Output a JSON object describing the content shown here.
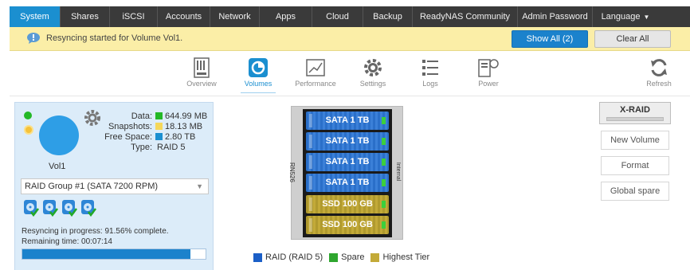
{
  "nav": {
    "items": [
      {
        "label": "System",
        "active": true
      },
      {
        "label": "Shares"
      },
      {
        "label": "iSCSI"
      },
      {
        "label": "Accounts"
      },
      {
        "label": "Network"
      },
      {
        "label": "Apps"
      },
      {
        "label": "Cloud"
      },
      {
        "label": "Backup"
      },
      {
        "label": "ReadyNAS Community"
      },
      {
        "label": "Admin Password"
      },
      {
        "label": "Language"
      }
    ]
  },
  "notification": {
    "message": "Resyncing started for Volume Vol1.",
    "show_all_label": "Show All (2)",
    "clear_all_label": "Clear All"
  },
  "toolbar": {
    "overview": "Overview",
    "volumes": "Volumes",
    "performance": "Performance",
    "settings": "Settings",
    "logs": "Logs",
    "power": "Power",
    "refresh": "Refresh"
  },
  "volume": {
    "name": "Vol1",
    "data_label": "Data:",
    "data_value": "644.99 MB",
    "snapshots_label": "Snapshots:",
    "snapshots_value": "18.13 MB",
    "free_label": "Free Space:",
    "free_value": "2.80 TB",
    "type_label": "Type:",
    "type_value": "RAID 5",
    "raid_group": "RAID Group #1 (SATA 7200 RPM)",
    "progress_line1": "Resyncing in progress: 91.56% complete.",
    "progress_line2": "Remaining time: 00:07:14",
    "progress_percent": 91.56
  },
  "colors": {
    "data": "#23b826",
    "snapshots": "#f5d75a",
    "free": "#1b8fd0",
    "raid": "#1b5fc7",
    "spare": "#2ea62e",
    "highest_tier": "#c3aa38"
  },
  "enclosure": {
    "model_label": "RN526",
    "side_label": "Internal",
    "bays": [
      {
        "label": "SATA 1 TB",
        "kind": "sata"
      },
      {
        "label": "SATA 1 TB",
        "kind": "sata"
      },
      {
        "label": "SATA 1 TB",
        "kind": "sata"
      },
      {
        "label": "SATA 1 TB",
        "kind": "sata"
      },
      {
        "label": "SSD 100 GB",
        "kind": "ssd"
      },
      {
        "label": "SSD 100 GB",
        "kind": "ssd"
      }
    ]
  },
  "legend": {
    "raid": "RAID (RAID 5)",
    "spare": "Spare",
    "highest_tier": "Highest Tier"
  },
  "side_buttons": {
    "xraid": "X-RAID",
    "new_volume": "New Volume",
    "format": "Format",
    "global_spare": "Global spare"
  }
}
